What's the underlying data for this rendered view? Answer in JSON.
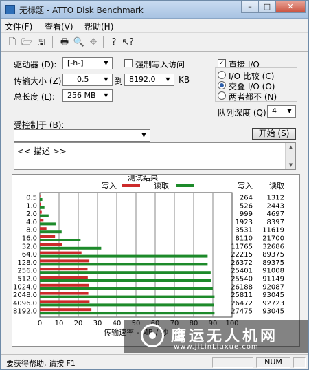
{
  "window": {
    "title": "无标题 - ATTO Disk Benchmark",
    "minimize_glyph": "–",
    "maximize_glyph": "□",
    "close_glyph": "✕"
  },
  "menu": [
    {
      "label": "文件(F)"
    },
    {
      "label": "查看(V)"
    },
    {
      "label": "帮助(H)"
    }
  ],
  "toolbar": [
    {
      "name": "new-icon",
      "glyph": "🗋",
      "enabled": true
    },
    {
      "name": "open-icon",
      "glyph": "🗁",
      "enabled": true
    },
    {
      "name": "save-icon",
      "glyph": "🖫",
      "enabled": true
    },
    {
      "name": "print-icon",
      "glyph": "🖶",
      "enabled": true
    },
    {
      "name": "print-preview-icon",
      "glyph": "🔍",
      "enabled": true
    },
    {
      "name": "move-icon",
      "glyph": "✥",
      "enabled": false
    },
    {
      "name": "help-icon",
      "glyph": "?",
      "enabled": true
    },
    {
      "name": "context-help-icon",
      "glyph": "↖?",
      "enabled": true
    }
  ],
  "settings": {
    "drive_label": "驱动器 (D):",
    "drive_value": "[-h-]",
    "force_write_label": "强制写入访问",
    "force_write_checked": false,
    "direct_io_label": "直接 I/O",
    "direct_io_checked": true,
    "transfer_size_label": "传输大小 (Z):",
    "transfer_from": "0.5",
    "to_label": "到",
    "transfer_to": "8192.0",
    "unit_label": "KB",
    "io_compare_label": "I/O 比较 (C)",
    "overlapped_io_label": "交叠 I/O (O)",
    "neither_label": "两者都不 (N)",
    "selected_mode": "overlapped",
    "total_length_label": "总长度 (L):",
    "total_length_value": "256 MB",
    "queue_depth_label": "队列深度 (Q):",
    "queue_depth_value": "4",
    "controlled_by_label": "受控制于 (B):",
    "controlled_by_value": "",
    "start_button": "开始 (S)",
    "description_text": "<< 描述 >>"
  },
  "chart_data": {
    "type": "bar",
    "title": "测试结果",
    "xlabel": "传输速率 - MB / 秒",
    "xlim": [
      0,
      100
    ],
    "x_ticks": [
      "0",
      "10",
      "20",
      "30",
      "40",
      "50",
      "60",
      "70",
      "80",
      "90",
      "100"
    ],
    "categories": [
      "0.5",
      "1.0",
      "2.0",
      "4.0",
      "8.0",
      "16.0",
      "32.0",
      "64.0",
      "128.0",
      "256.0",
      "512.0",
      "1024.0",
      "2048.0",
      "4096.0",
      "8192.0"
    ],
    "legend": {
      "write_label": "写入",
      "read_label": "读取",
      "placement": "top"
    },
    "column_headers": {
      "write": "写入",
      "read": "读取"
    },
    "series": [
      {
        "name": "写入",
        "color": "#cc2a2a",
        "values": [
          0.26,
          0.51,
          0.98,
          1.88,
          3.45,
          7.92,
          11.49,
          21.69,
          25.75,
          24.81,
          24.94,
          25.57,
          25.21,
          25.85,
          26.83
        ]
      },
      {
        "name": "读取",
        "color": "#1d8a2a",
        "values": [
          1.28,
          2.39,
          4.59,
          8.2,
          11.35,
          21.19,
          31.92,
          87.28,
          87.28,
          88.88,
          89.01,
          89.93,
          90.86,
          90.55,
          90.86
        ]
      }
    ],
    "table": {
      "write": [
        "264",
        "526",
        "999",
        "1923",
        "3531",
        "8110",
        "11765",
        "22215",
        "26372",
        "25401",
        "25540",
        "26188",
        "25811",
        "26472",
        "27475"
      ],
      "read": [
        "1312",
        "2443",
        "4697",
        "8397",
        "11619",
        "21700",
        "32686",
        "89375",
        "89375",
        "91008",
        "91149",
        "92087",
        "93045",
        "92723",
        "93045"
      ]
    }
  },
  "statusbar": {
    "text": "要获得帮助, 请按 F1",
    "num": "NUM"
  },
  "watermark": {
    "text": "鹰运无人机网",
    "url": "www.jiLinLiuxue.com"
  }
}
